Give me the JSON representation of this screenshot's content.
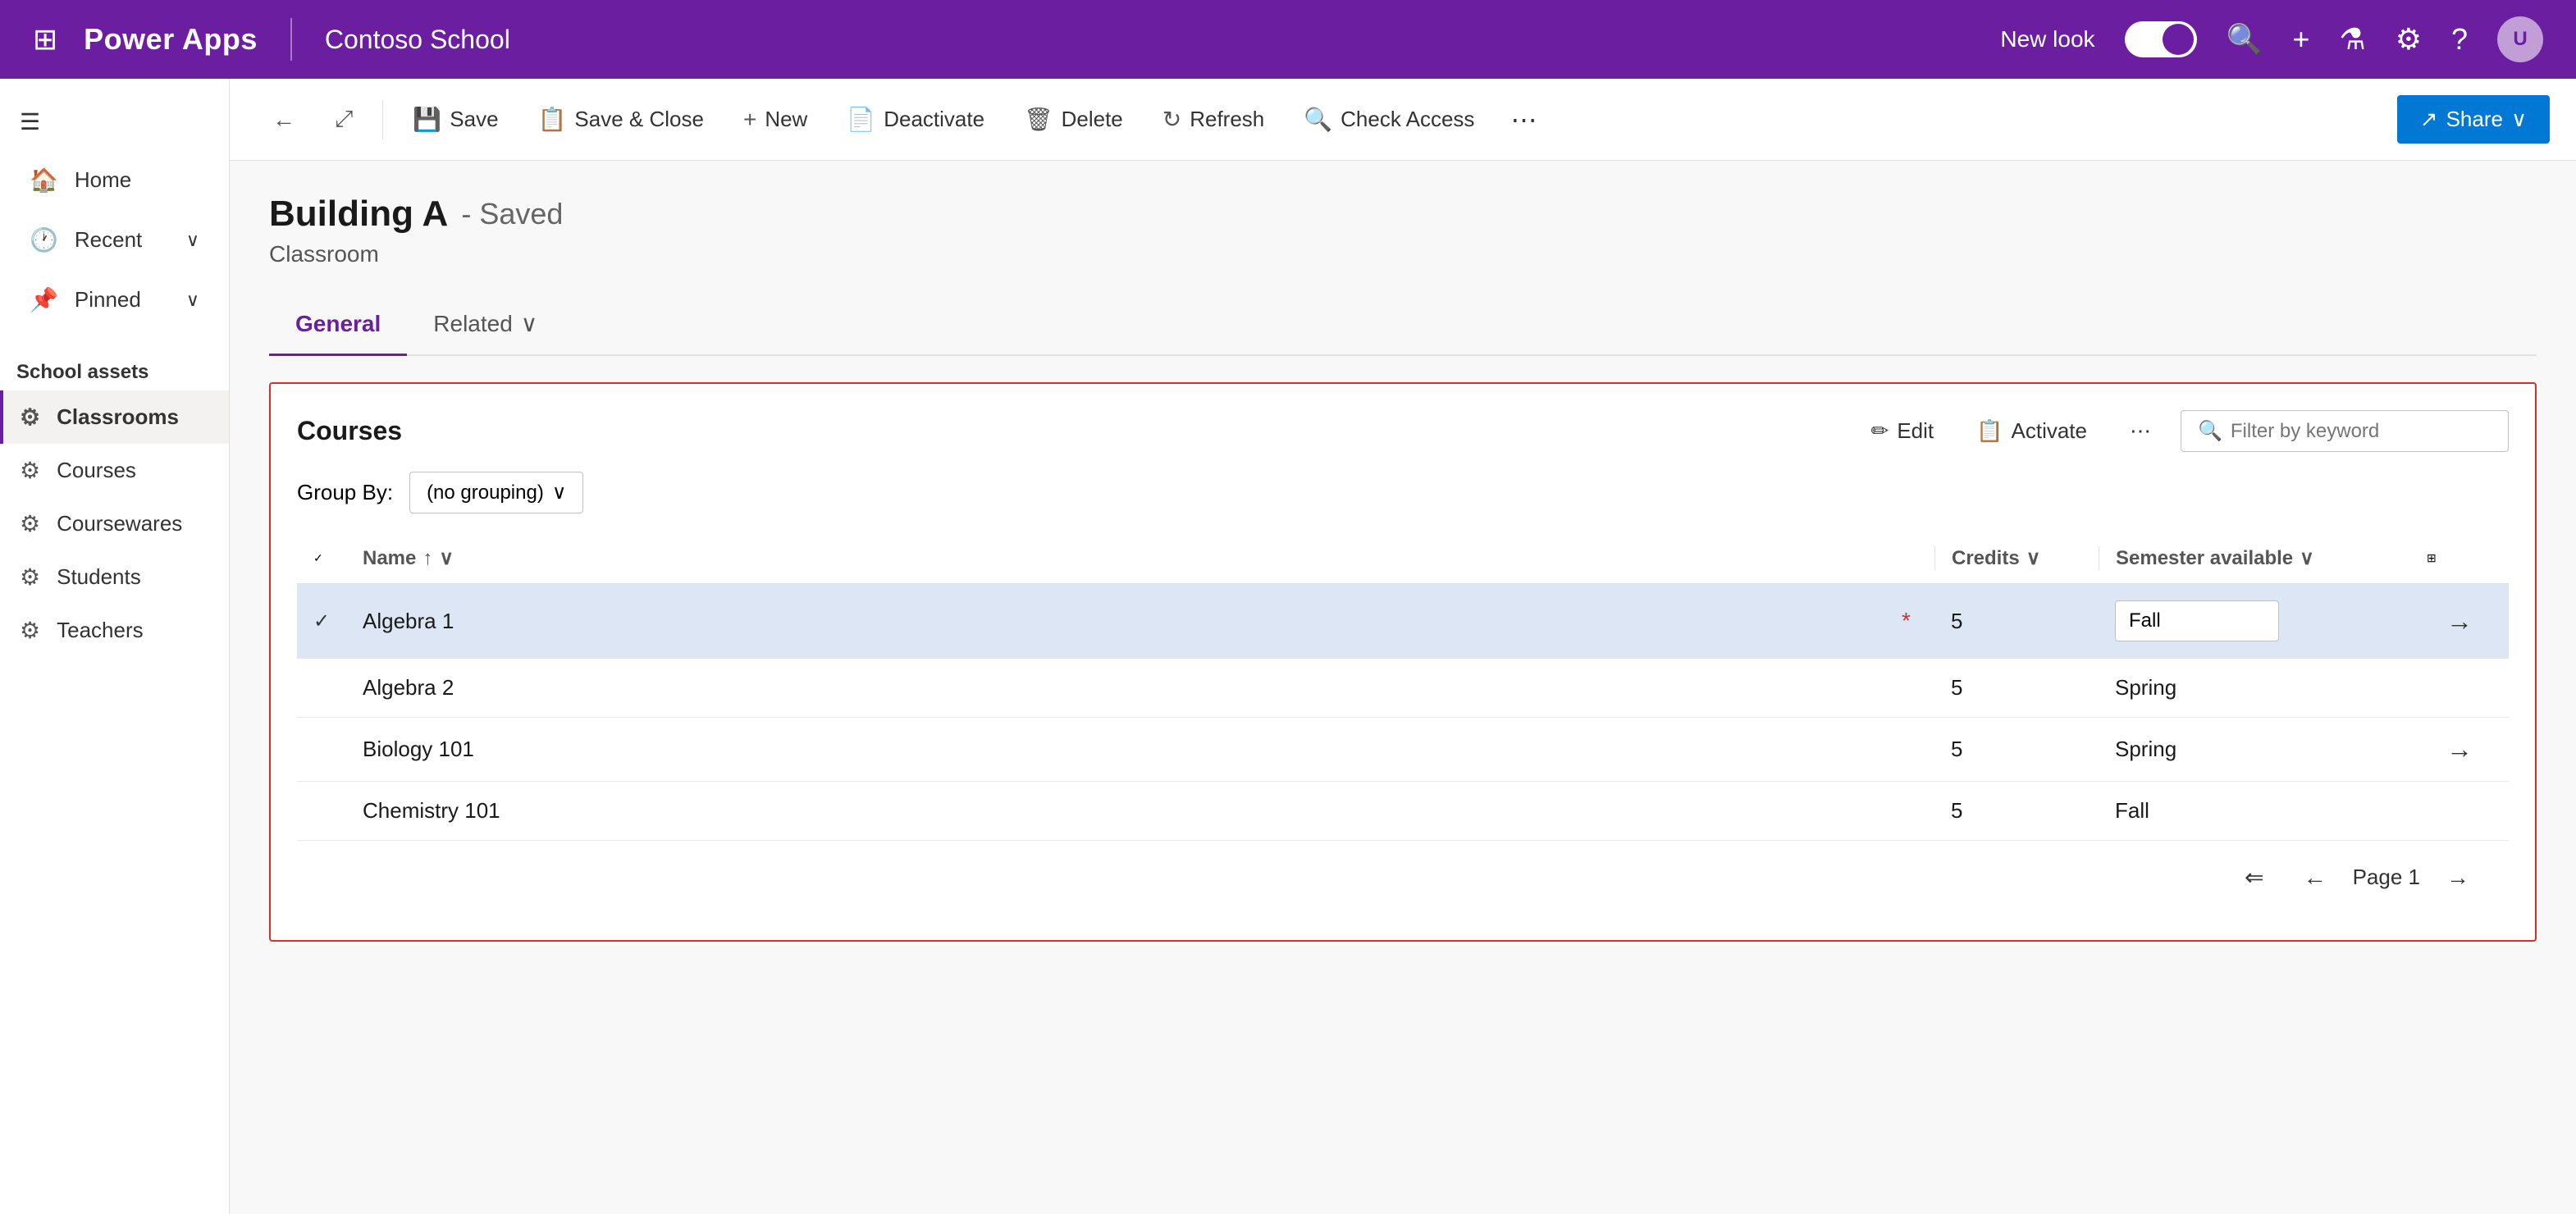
{
  "topNav": {
    "waffle": "⊞",
    "brand": "Power Apps",
    "app": "Contoso School",
    "newLookLabel": "New look",
    "avatarInitials": "U"
  },
  "toolbar": {
    "backLabel": "←",
    "openInNewLabel": "⤢",
    "saveLabel": "Save",
    "saveCloseLabel": "Save & Close",
    "newLabel": "New",
    "deactivateLabel": "Deactivate",
    "deleteLabel": "Delete",
    "refreshLabel": "Refresh",
    "checkAccessLabel": "Check Access",
    "moreLabel": "⋯",
    "shareLabel": "Share"
  },
  "record": {
    "title": "Building A",
    "savedStatus": "- Saved",
    "subtitle": "Classroom"
  },
  "tabs": [
    {
      "label": "General",
      "active": true
    },
    {
      "label": "Related",
      "active": false
    }
  ],
  "coursesSection": {
    "title": "Courses",
    "editLabel": "Edit",
    "activateLabel": "Activate",
    "filterPlaceholder": "Filter by keyword",
    "groupByLabel": "Group By:",
    "groupByValue": "(no grouping)"
  },
  "tableHeaders": {
    "name": "Name",
    "nameSortAsc": "↑",
    "credits": "Credits",
    "semesterAvailable": "Semester available"
  },
  "courses": [
    {
      "id": 1,
      "selected": true,
      "name": "Algebra 1",
      "hasAsterisk": true,
      "credits": 5,
      "semester": "Fall",
      "semesterEditable": true,
      "hasArrow": true
    },
    {
      "id": 2,
      "selected": false,
      "name": "Algebra 2",
      "hasAsterisk": false,
      "credits": 5,
      "semester": "Spring",
      "semesterEditable": false,
      "hasArrow": false
    },
    {
      "id": 3,
      "selected": false,
      "name": "Biology 101",
      "hasAsterisk": false,
      "credits": 5,
      "semester": "Spring",
      "semesterEditable": false,
      "hasArrow": true
    },
    {
      "id": 4,
      "selected": false,
      "name": "Chemistry 101",
      "hasAsterisk": false,
      "credits": 5,
      "semester": "Fall",
      "semesterEditable": false,
      "hasArrow": false
    }
  ],
  "pagination": {
    "pageLabel": "Page 1"
  },
  "sidebar": {
    "sectionTitle": "School assets",
    "navItems": [
      {
        "label": "Home",
        "icon": "🏠"
      },
      {
        "label": "Recent",
        "icon": "🕐",
        "hasChevron": true
      },
      {
        "label": "Pinned",
        "icon": "📌",
        "hasChevron": true
      }
    ],
    "assetItems": [
      {
        "label": "Classrooms",
        "icon": "⚙",
        "active": true
      },
      {
        "label": "Courses",
        "icon": "⚙",
        "active": false
      },
      {
        "label": "Coursewares",
        "icon": "⚙",
        "active": false
      },
      {
        "label": "Students",
        "icon": "⚙",
        "active": false
      },
      {
        "label": "Teachers",
        "icon": "⚙",
        "active": false
      }
    ]
  }
}
